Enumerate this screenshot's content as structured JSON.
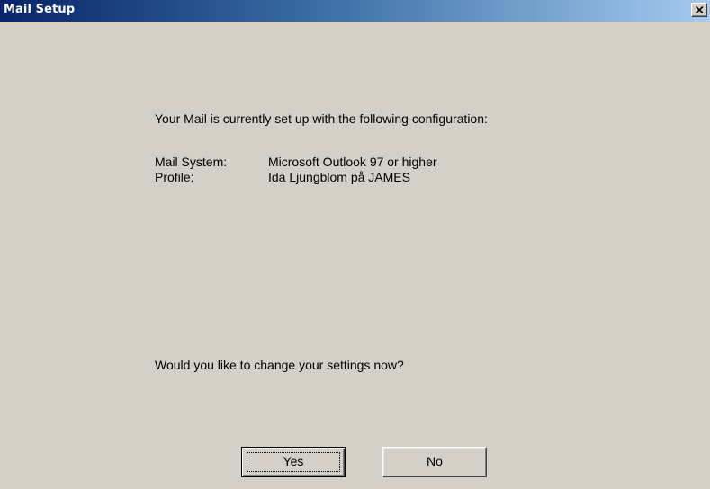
{
  "window": {
    "title": "Mail Setup",
    "close_icon": "close-x-icon"
  },
  "content": {
    "intro": "Your Mail is currently set up with the following configuration:",
    "mail_system_label": "Mail System:",
    "mail_system_value": "Microsoft Outlook 97 or higher",
    "profile_label": "Profile:",
    "profile_value": "Ida Ljungblom på JAMES",
    "question": "Would you like to change your settings now?"
  },
  "buttons": {
    "yes": {
      "mnemonic": "Y",
      "rest": "es",
      "is_default": true
    },
    "no": {
      "mnemonic": "N",
      "rest": "o",
      "is_default": false
    }
  },
  "colors": {
    "title_gradient_start": "#0a246a",
    "title_gradient_end": "#a6caf0",
    "dialog_face": "#d4d0c8"
  }
}
